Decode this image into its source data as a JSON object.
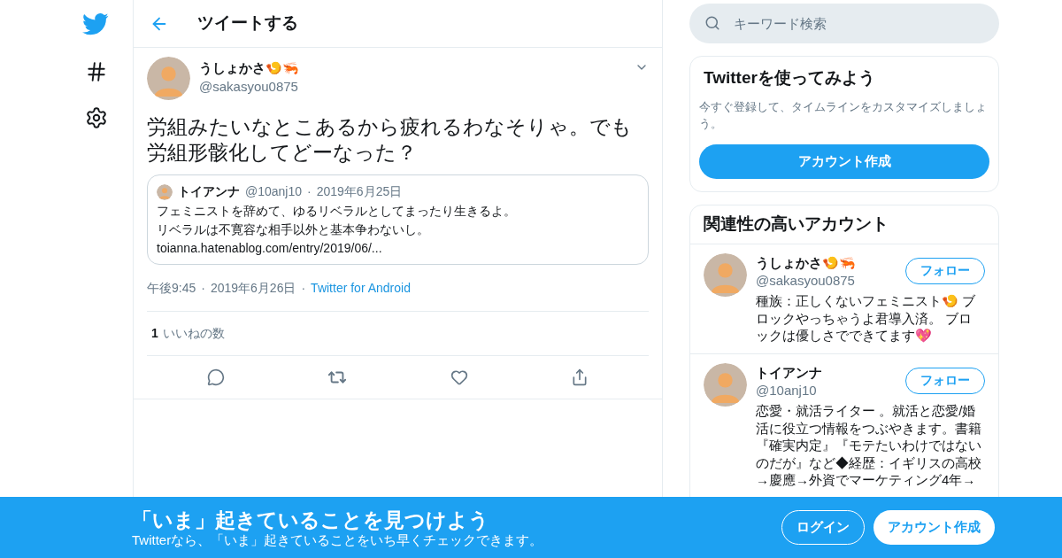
{
  "header": {
    "title": "ツイートする"
  },
  "tweet": {
    "author": {
      "name": "うしょかさ🍤🦐",
      "handle": "@sakasyou0875"
    },
    "text": "労組みたいなとこあるから疲れるわなそりゃ。でも労組形骸化してどーなった？",
    "quote": {
      "name": "トイアンナ",
      "handle": "@10anj10",
      "separator": "·",
      "date": "2019年6月25日",
      "lines": [
        "フェミニストを辞めて、ゆるリベラルとしてまったり生きるよ。",
        "リベラルは不寛容な相手以外と基本争わないし。",
        "toianna.hatenablog.com/entry/2019/06/..."
      ]
    },
    "meta": {
      "time": "午後9:45",
      "separator": "·",
      "date": "2019年6月26日",
      "source": "Twitter for Android"
    },
    "likes": {
      "count": "1",
      "label": "いいねの数"
    }
  },
  "search": {
    "placeholder": "キーワード検索"
  },
  "signup_card": {
    "title": "Twitterを使ってみよう",
    "text": "今すぐ登録して、タイムラインをカスタマイズしましょう。",
    "button": "アカウント作成"
  },
  "related": {
    "title": "関連性の高いアカウント",
    "accounts": [
      {
        "name": "うしょかさ🍤🦐",
        "handle": "@sakasyou0875",
        "button": "フォロー",
        "bio": "種族：正しくないフェミニスト🍤 ブロックやっちゃうよ君導入済。 ブロックは優しさでできてます💖"
      },
      {
        "name": "トイアンナ",
        "handle": "@10anj10",
        "button": "フォロー",
        "bio": "恋愛・就活ライター 。就活と恋愛/婚活に役立つ情報をつぶやきます。書籍『確実内定』『モテたいわけではないのだが』など◆経歴：イギリスの高校→慶應→外資でマーケティング4年→"
      }
    ]
  },
  "banner": {
    "title": "「いま」起きていることを見つけよう",
    "subtitle": "Twitterなら、「いま」起きていることをいち早くチェックできます。",
    "buttons": [
      {
        "label": "ログイン",
        "kind": "outline"
      },
      {
        "label": "アカウント作成",
        "kind": "solid"
      }
    ]
  }
}
